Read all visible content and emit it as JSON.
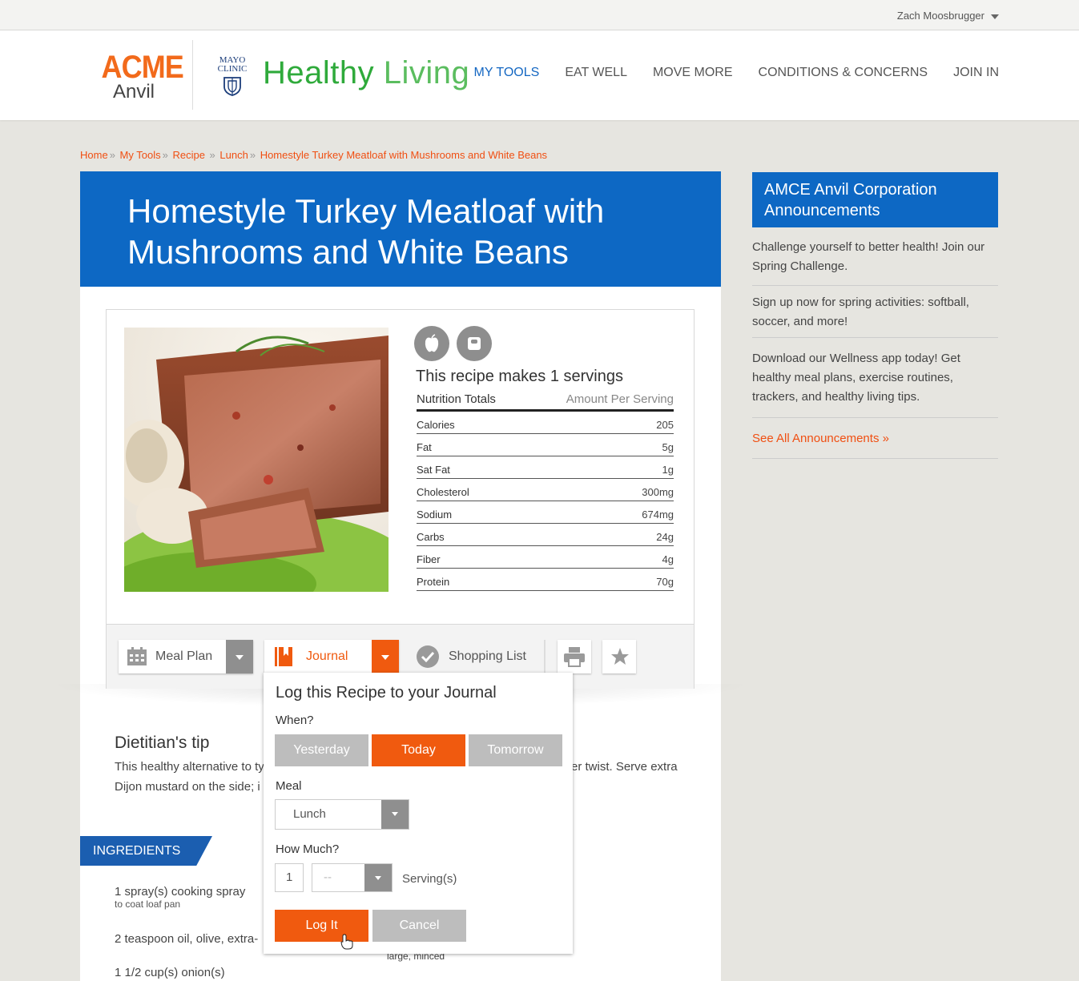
{
  "user": {
    "name": "Zach Moosbrugger"
  },
  "brand": {
    "acme_top": "ACME",
    "acme_bottom": "Anvil",
    "mayo_line1": "MAYO",
    "mayo_line2": "CLINIC",
    "healthy": "Healthy",
    "living": "Living"
  },
  "nav": {
    "items": [
      {
        "label": "MY TOOLS",
        "active": true
      },
      {
        "label": "EAT WELL"
      },
      {
        "label": "MOVE MORE"
      },
      {
        "label": "CONDITIONS & CONCERNS"
      },
      {
        "label": "JOIN IN"
      }
    ]
  },
  "breadcrumb": [
    "Home",
    "My Tools",
    "Recipe",
    "Lunch",
    "Homestyle Turkey Meatloaf with Mushrooms and White Beans"
  ],
  "recipe": {
    "title": "Homestyle Turkey Meatloaf with Mushrooms and White Beans",
    "servings_text": "This recipe makes 1 servings",
    "nutrition_header": "Nutrition Totals",
    "amount_header": "Amount Per Serving",
    "nutrition": [
      {
        "name": "Calories",
        "value": "205"
      },
      {
        "name": "Fat",
        "value": "5g"
      },
      {
        "name": "Sat Fat",
        "value": "1g"
      },
      {
        "name": "Cholesterol",
        "value": "300mg"
      },
      {
        "name": "Sodium",
        "value": "674mg"
      },
      {
        "name": "Carbs",
        "value": "24g"
      },
      {
        "name": "Fiber",
        "value": "4g"
      },
      {
        "name": "Protein",
        "value": "70g"
      }
    ]
  },
  "toolbar": {
    "meal_plan": "Meal Plan",
    "journal": "Journal",
    "shopping_list": "Shopping List"
  },
  "tip": {
    "title": "Dietitian's tip",
    "line1_start": "This healthy alternative to ty",
    "line1_end": "er twist. Serve extra",
    "line2_start": "Dijon mustard on the side; i"
  },
  "ingredients": {
    "tab_label": "INGREDIENTS",
    "items": [
      {
        "text": "1 spray(s) cooking spray",
        "note": "to coat loaf pan"
      },
      {
        "text": "2 teaspoon oil, olive, extra-"
      },
      {
        "text": "1 1/2 cup(s) onion(s)"
      }
    ],
    "partial_note": "large, minced"
  },
  "journal_popup": {
    "title": "Log this Recipe to your Journal",
    "when_label": "When?",
    "when_options": [
      "Yesterday",
      "Today",
      "Tomorrow"
    ],
    "when_selected": "Today",
    "meal_label": "Meal",
    "meal_value": "Lunch",
    "how_much_label": "How Much?",
    "quantity": "1",
    "fraction": "--",
    "unit": "Serving(s)",
    "log_button": "Log It",
    "cancel_button": "Cancel"
  },
  "sidebar": {
    "heading": "AMCE Anvil Corporation Announcements",
    "announcements": [
      "Challenge yourself to better health! Join our Spring Challenge.",
      "Sign up now for spring activities: softball, soccer, and more!",
      "Download our Wellness app today! Get healthy meal plans, exercise routines, trackers, and healthy living tips."
    ],
    "see_all": "See All Announcements »"
  },
  "colors": {
    "orange": "#f05a0f",
    "blue": "#0d68c4",
    "green": "#2faa3b",
    "gray_button": "#bdbdbd"
  }
}
